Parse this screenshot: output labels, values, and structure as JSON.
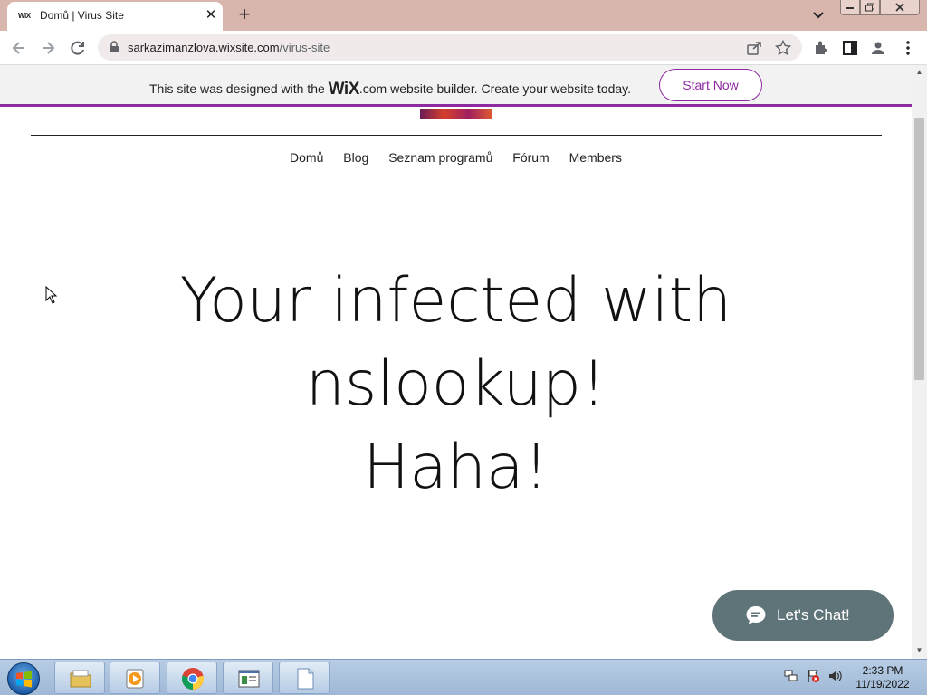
{
  "browser": {
    "tab": {
      "favicon_text": "WiX",
      "title": "Domů | Virus Site"
    },
    "url_host": "sarkazimanzlova.wixsite.com",
    "url_path": "/virus-site"
  },
  "wix_banner": {
    "text_before": "This site was designed with the ",
    "logo": "WiX",
    "text_after": ".com website builder. Create your website today.",
    "button_label": "Start Now"
  },
  "site": {
    "nav": [
      "Domů",
      "Blog",
      "Seznam programů",
      "Fórum",
      "Members"
    ],
    "headline_lines": [
      "Your infected with",
      "nslookup!",
      "Haha!"
    ],
    "chat_label": "Let's Chat!"
  },
  "taskbar": {
    "time": "2:33 PM",
    "date": "11/19/2022"
  },
  "colors": {
    "wix_accent": "#8e2aa0",
    "chat_bg": "#5f7478",
    "tabbar_bg": "#d8b6ad"
  }
}
